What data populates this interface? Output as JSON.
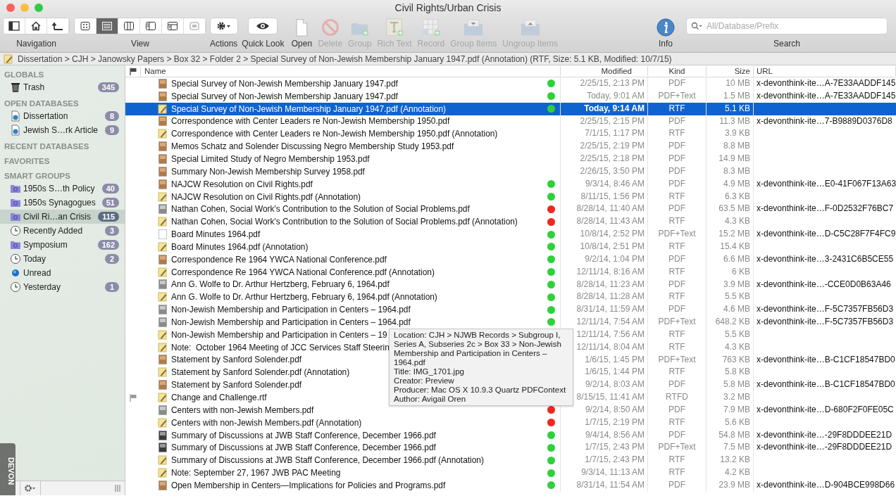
{
  "window": {
    "title": "Civil Rights/Urban Crisis"
  },
  "toolbar": {
    "navigation": {
      "label": "Navigation"
    },
    "view": {
      "label": "View",
      "modes": [
        {
          "kind": "icons",
          "selected": false
        },
        {
          "kind": "list",
          "selected": true
        },
        {
          "kind": "columns",
          "selected": false
        },
        {
          "kind": "split",
          "selected": false
        },
        {
          "kind": "three-pane",
          "selected": false
        },
        {
          "kind": "preview",
          "selected": false
        }
      ]
    },
    "actions": {
      "label": "Actions"
    },
    "quick_look": {
      "label": "Quick Look"
    },
    "tools": [
      {
        "kind": "open",
        "label": "Open",
        "disabled": false
      },
      {
        "kind": "delete",
        "label": "Delete",
        "disabled": true
      },
      {
        "kind": "group",
        "label": "Group",
        "disabled": true
      },
      {
        "kind": "rich-text",
        "label": "Rich Text",
        "disabled": true
      },
      {
        "kind": "record",
        "label": "Record",
        "disabled": true
      },
      {
        "kind": "group-items",
        "label": "Group Items",
        "disabled": true
      },
      {
        "kind": "ungroup-items",
        "label": "Ungroup Items",
        "disabled": true
      }
    ],
    "info": {
      "label": "Info"
    },
    "search": {
      "placeholder": "All/Database/Prefix",
      "label": "Search"
    }
  },
  "path_bar": {
    "text": "Dissertation > CJH > Janowsky Papers > Box 32 > Folder 2 > Special Survey of Non-Jewish Membership January 1947.pdf (Annotation) (RTF, Size: 5.1 KB, Modified: 10/7/15)"
  },
  "sidebar": {
    "sections": [
      {
        "title": "GLOBALS",
        "items": [
          {
            "kind": "trash",
            "label": "Trash",
            "count": "345",
            "selected": false
          }
        ]
      },
      {
        "title": "OPEN DATABASES",
        "items": [
          {
            "kind": "database",
            "label": "Dissertation",
            "count": "8",
            "selected": false
          },
          {
            "kind": "database",
            "label": "Jewish S…rk Article",
            "count": "9",
            "selected": false
          }
        ]
      },
      {
        "title": "RECENT DATABASES"
      },
      {
        "title": "FAVORITES"
      },
      {
        "title": "SMART GROUPS",
        "items": [
          {
            "kind": "smart",
            "label": "1950s S…th Policy",
            "count": "40",
            "selected": false
          },
          {
            "kind": "smart",
            "label": "1950s Synagogues",
            "count": "51",
            "selected": false
          },
          {
            "kind": "smart",
            "label": "Civil Ri…an Crisis",
            "count": "115",
            "selected": true
          },
          {
            "kind": "clock",
            "label": "Recently Added",
            "count": "3",
            "selected": false
          },
          {
            "kind": "smart",
            "label": "Symposium",
            "count": "162",
            "selected": false
          },
          {
            "kind": "clock",
            "label": "Today",
            "count": "2",
            "selected": false
          },
          {
            "kind": "unread",
            "label": "Unread",
            "selected": false
          },
          {
            "kind": "clock",
            "label": "Yesterday",
            "count": "1",
            "selected": false
          }
        ]
      }
    ],
    "side_tab": "DEVON"
  },
  "table": {
    "columns": [
      "Name",
      "Modified",
      "Kind",
      "Size",
      "URL"
    ],
    "rows": [
      {
        "kind": "sepia",
        "name": "Special Survey of Non-Jewish Membership January 1947.pdf",
        "color": "#2ed13a",
        "modified": "2/25/15, 2:13 PM",
        "doc_kind": "PDF",
        "size": "10 MB",
        "url": "x-devonthink-ite…A-7E33AADDF145",
        "flagged": false,
        "selected": false
      },
      {
        "kind": "sepia",
        "name": "Special Survey of Non-Jewish Membership January 1947.pdf",
        "color": "#2ed13a",
        "modified": "Today, 9:01 AM",
        "doc_kind": "PDF+Text",
        "size": "1.5 MB",
        "url": "x-devonthink-ite…A-7E33AADDF145",
        "flagged": false,
        "selected": false
      },
      {
        "kind": "note",
        "name": "Special Survey of Non-Jewish Membership January 1947.pdf (Annotation)",
        "color": "#2ed13a",
        "modified": "Today, 9:14 AM",
        "doc_kind": "RTF",
        "size": "5.1 KB",
        "flagged": false,
        "selected": true
      },
      {
        "kind": "sepia",
        "name": "Correspondence with Center Leaders re Non-Jewish Membership 1950.pdf",
        "modified": "2/25/15, 2:15 PM",
        "doc_kind": "PDF",
        "size": "11.3 MB",
        "url": "x-devonthink-ite…7-B9889D0376D8",
        "flagged": false,
        "selected": false
      },
      {
        "kind": "note",
        "name": "Correspondence with Center Leaders re Non-Jewish Membership 1950.pdf (Annotation)",
        "modified": "7/1/15, 1:17 PM",
        "doc_kind": "RTF",
        "size": "3.9 KB",
        "flagged": false,
        "selected": false
      },
      {
        "kind": "sepia",
        "name": "Memos Schatz and Solender Discussing Negro Membership Study 1953.pdf",
        "modified": "2/25/15, 2:19 PM",
        "doc_kind": "PDF",
        "size": "8.8 MB",
        "flagged": false,
        "selected": false
      },
      {
        "kind": "sepia",
        "name": "Special Limited Study of Negro Membership 1953.pdf",
        "modified": "2/25/15, 2:18 PM",
        "doc_kind": "PDF",
        "size": "14.9 MB",
        "flagged": false,
        "selected": false
      },
      {
        "kind": "sepia",
        "name": "Summary Non-Jewish Membership Survey 1958.pdf",
        "modified": "2/26/15, 3:50 PM",
        "doc_kind": "PDF",
        "size": "8.3 MB",
        "flagged": false,
        "selected": false
      },
      {
        "kind": "sepia",
        "name": "NAJCW Resolution on Civil Rights.pdf",
        "color": "#2ed13a",
        "modified": "9/3/14, 8:46 AM",
        "doc_kind": "PDF",
        "size": "4.9 MB",
        "url": "x-devonthink-ite…E0-41F067F13A63",
        "flagged": false,
        "selected": false
      },
      {
        "kind": "note",
        "name": "NAJCW Resolution on Civil Rights.pdf (Annotation)",
        "color": "#2ed13a",
        "modified": "8/11/15, 1:56 PM",
        "doc_kind": "RTF",
        "size": "6.3 KB",
        "flagged": false,
        "selected": false
      },
      {
        "kind": "gray",
        "name": "Nathan Cohen, Social Work's Contribution to the Solution of Social Problems.pdf",
        "color": "#f0261f",
        "modified": "8/28/14, 11:40 AM",
        "doc_kind": "PDF",
        "size": "63.5 MB",
        "url": "x-devonthink-ite…F-0D2532F76BC7",
        "flagged": false,
        "selected": false
      },
      {
        "kind": "note",
        "name": "Nathan Cohen, Social Work's Contribution to the Solution of Social Problems.pdf (Annotation)",
        "color": "#f0261f",
        "modified": "8/28/14, 11:43 AM",
        "doc_kind": "RTF",
        "size": "4.3 KB",
        "flagged": false,
        "selected": false
      },
      {
        "kind": "page",
        "name": "Board Minutes 1964.pdf",
        "color": "#2ed13a",
        "modified": "10/8/14, 2:52 PM",
        "doc_kind": "PDF+Text",
        "size": "15.2 MB",
        "url": "x-devonthink-ite…D-C5C28F7F4FC9",
        "flagged": false,
        "selected": false
      },
      {
        "kind": "note",
        "name": "Board Minutes 1964.pdf (Annotation)",
        "color": "#2ed13a",
        "modified": "10/8/14, 2:51 PM",
        "doc_kind": "RTF",
        "size": "15.4 KB",
        "flagged": false,
        "selected": false
      },
      {
        "kind": "sepia",
        "name": "Correspondence Re 1964 YWCA National Conference.pdf",
        "color": "#2ed13a",
        "modified": "9/2/14, 1:04 PM",
        "doc_kind": "PDF",
        "size": "6.6 MB",
        "url": "x-devonthink-ite…3-2431C6B5CE55",
        "flagged": false,
        "selected": false
      },
      {
        "kind": "note",
        "name": "Correspondence Re 1964 YWCA National Conference.pdf (Annotation)",
        "color": "#2ed13a",
        "modified": "12/11/14, 8:16 AM",
        "doc_kind": "RTF",
        "size": "6 KB",
        "flagged": false,
        "selected": false
      },
      {
        "kind": "gray",
        "name": "Ann G. Wolfe to Dr. Arthur Hertzberg, February 6, 1964.pdf",
        "color": "#2ed13a",
        "modified": "8/28/14, 11:23 AM",
        "doc_kind": "PDF",
        "size": "3.9 MB",
        "url": "x-devonthink-ite…-CCE0D0B63A46",
        "flagged": false,
        "selected": false
      },
      {
        "kind": "note",
        "name": "Ann G. Wolfe to Dr. Arthur Hertzberg, February 6, 1964.pdf (Annotation)",
        "color": "#2ed13a",
        "modified": "8/28/14, 11:28 AM",
        "doc_kind": "RTF",
        "size": "5.5 KB",
        "flagged": false,
        "selected": false
      },
      {
        "kind": "gray",
        "name": "Non-Jewish Membership and Participation in Centers – 1964.pdf",
        "color": "#2ed13a",
        "modified": "8/31/14, 11:59 AM",
        "doc_kind": "PDF",
        "size": "4.6 MB",
        "url": "x-devonthink-ite…F-5C7357FB56D3",
        "flagged": false,
        "selected": false
      },
      {
        "kind": "gray",
        "name": "Non-Jewish Membership and Participation in Centers – 1964.pdf",
        "color": "#2ed13a",
        "modified": "12/11/14, 7:54 AM",
        "doc_kind": "PDF+Text",
        "size": "648.2 KB",
        "url": "x-devonthink-ite…F-5C7357FB56D3",
        "flagged": false,
        "selected": false
      },
      {
        "kind": "note",
        "name": "Non-Jewish Membership and Participation in Centers – 19",
        "modified": "12/11/14, 7:56 AM",
        "doc_kind": "RTF",
        "size": "5.5 KB",
        "flagged": false,
        "selected": false
      },
      {
        "kind": "note",
        "name": "Note:  October 1964 Meeting of JCC Services Staff Steerin",
        "modified": "12/11/14, 8:04 AM",
        "doc_kind": "RTF",
        "size": "4.3 KB",
        "flagged": false,
        "selected": false
      },
      {
        "kind": "sepia",
        "name": "Statement by Sanford Solender.pdf",
        "modified": "1/6/15, 1:45 PM",
        "doc_kind": "PDF+Text",
        "size": "763 KB",
        "url": "x-devonthink-ite…B-C1CF18547BD0",
        "flagged": false,
        "selected": false
      },
      {
        "kind": "note",
        "name": "Statement by Sanford Solender.pdf (Annotation)",
        "modified": "1/6/15, 1:44 PM",
        "doc_kind": "RTF",
        "size": "5.8 KB",
        "flagged": false,
        "selected": false
      },
      {
        "kind": "sepia",
        "name": "Statement by Sanford Solender.pdf",
        "modified": "9/2/14, 8:03 AM",
        "doc_kind": "PDF",
        "size": "5.8 MB",
        "url": "x-devonthink-ite…B-C1CF18547BD0",
        "flagged": false,
        "selected": false
      },
      {
        "kind": "note",
        "name": "Change and Challenge.rtf",
        "modified": "8/15/15, 11:41 AM",
        "doc_kind": "RTFD",
        "size": "3.2 MB",
        "flagged": true,
        "selected": false
      },
      {
        "kind": "gray",
        "name": "Centers with non-Jewish Members.pdf",
        "color": "#f0261f",
        "modified": "9/2/14, 8:50 AM",
        "doc_kind": "PDF",
        "size": "7.9 MB",
        "url": "x-devonthink-ite…D-680F2F0FE05C",
        "flagged": false,
        "selected": false
      },
      {
        "kind": "note",
        "name": "Centers with non-Jewish Members.pdf (Annotation)",
        "color": "#f0261f",
        "modified": "1/7/15, 2:19 PM",
        "doc_kind": "RTF",
        "size": "5.6 KB",
        "flagged": false,
        "selected": false
      },
      {
        "kind": "dark",
        "name": "Summary of Discussions at JWB Staff Conference, December 1966.pdf",
        "color": "#2ed13a",
        "modified": "9/4/14, 8:56 AM",
        "doc_kind": "PDF",
        "size": "54.8 MB",
        "url": "x-devonthink-ite…-29F8DDDEE21D",
        "flagged": false,
        "selected": false
      },
      {
        "kind": "dark",
        "name": "Summary of Discussions at JWB Staff Conference, December 1966.pdf",
        "color": "#2ed13a",
        "modified": "1/7/15, 2:43 PM",
        "doc_kind": "PDF+Text",
        "size": "7.5 MB",
        "url": "x-devonthink-ite…-29F8DDDEE21D",
        "flagged": false,
        "selected": false
      },
      {
        "kind": "note",
        "name": "Summary of Discussions at JWB Staff Conference, December 1966.pdf (Annotation)",
        "color": "#2ed13a",
        "modified": "1/7/15, 2:43 PM",
        "doc_kind": "RTF",
        "size": "13.2 KB",
        "flagged": false,
        "selected": false
      },
      {
        "kind": "note",
        "name": "Note: September 27, 1967 JWB PAC Meeting",
        "color": "#2ed13a",
        "modified": "9/3/14, 11:13 AM",
        "doc_kind": "RTF",
        "size": "4.2 KB",
        "flagged": false,
        "selected": false
      },
      {
        "kind": "sepia",
        "name": "Open Membership in Centers—Implications for Policies and Programs.pdf",
        "color": "#2ed13a",
        "modified": "8/31/14, 11:54 AM",
        "doc_kind": "PDF",
        "size": "23.9 MB",
        "url": "x-devonthink-ite…D-904BCE998D66",
        "flagged": false,
        "selected": false
      }
    ]
  },
  "tooltip": {
    "lines": [
      "Location: CJH > NJWB Records > Subgroup I, Series A, Subseries 2c > Box 33 > Non-Jewish Membership and Participation in Centers – 1964.pdf",
      "Title: IMG_1701.jpg",
      "Creator: Preview",
      "Producer: Mac OS X 10.9.3 Quartz PDFContext",
      "Author: Avigail Oren"
    ]
  }
}
